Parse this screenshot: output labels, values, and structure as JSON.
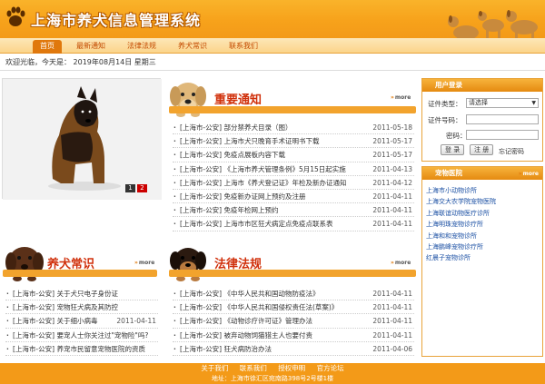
{
  "header": {
    "title": "上海市养犬信息管理系统",
    "logo_icon": "paw-icon",
    "banner_icon": "dogs-banner-image"
  },
  "nav": {
    "items": [
      "首页",
      "最新通知",
      "法律法规",
      "养犬常识",
      "联系我们"
    ],
    "active_index": 0
  },
  "welcome": {
    "text": "欢迎光临，今天是：  2019年08月14日 星期三"
  },
  "slideshow": {
    "pages": [
      "1",
      "2"
    ],
    "current": "2"
  },
  "notice": {
    "title": "重要通知",
    "more": "more",
    "items": [
      {
        "text": "[上海市-公安] 部分禁养犬目录（图）",
        "date": "2011-05-18"
      },
      {
        "text": "[上海市-公安] 上海市犬只晚育手术证明书下载",
        "date": "2011-05-17"
      },
      {
        "text": "[上海市-公安] 免疫点展板内容下载",
        "date": "2011-05-17"
      },
      {
        "text": "[上海市-公安] 《上海市养犬管理条例》5月15日起实施",
        "date": "2011-04-13"
      },
      {
        "text": "[上海市-公安] 上海市《养犬登记证》年检及新办证通知",
        "date": "2011-04-12"
      },
      {
        "text": "[上海市-公安] 免疫新办证网上预约及注册",
        "date": "2011-04-11"
      },
      {
        "text": "[上海市-公安] 免疫年检网上预约",
        "date": "2011-04-11"
      },
      {
        "text": "[上海市-公安] 上海市市区狂犬病定点免疫点联系表",
        "date": "2011-04-11"
      }
    ]
  },
  "knowledge": {
    "title": "养犬常识",
    "more": "more",
    "items": [
      {
        "text": "[上海市-公安] 关于犬只电子身份证",
        "date": ""
      },
      {
        "text": "[上海市-公安] 宠物狂犬病及其防控",
        "date": ""
      },
      {
        "text": "[上海市-公安] 关于细小病毒",
        "date": "2011-04-11"
      },
      {
        "text": "[上海市-公安] 要宠人士你关注过\"宠物险\"吗?",
        "date": ""
      },
      {
        "text": "[上海市-公安] 养宠市民留意宠物医院的资质",
        "date": ""
      }
    ]
  },
  "laws": {
    "title": "法律法规",
    "more": "more",
    "items": [
      {
        "text": "[上海市-公安] 《中华人民共和国动物防疫法》",
        "date": "2011-04-11"
      },
      {
        "text": "[上海市-公安] 《中华人民共和国侵权责任法(草案)》",
        "date": "2011-04-11"
      },
      {
        "text": "[上海市-公安] 《动物诊疗许可证》管理办法",
        "date": "2011-04-11"
      },
      {
        "text": "[上海市-公安] 被弃动物饲猫猎主人也要付责",
        "date": "2011-04-11"
      },
      {
        "text": "[上海市-公安] 狂犬病防治办法",
        "date": "2011-04-06"
      }
    ]
  },
  "login": {
    "title": "用户登录",
    "type_label": "证件类型：",
    "type_value": "请选择",
    "id_label": "证件号码：",
    "pwd_label": "密码：",
    "login_btn": "登 录",
    "register_btn": "注 册",
    "forgot": "忘记密码"
  },
  "hospitals": {
    "title": "宠物医院",
    "more": "more",
    "items": [
      "上海市小动物诊所",
      "上海交大农学院宠物医院",
      "上海联谊动物医疗诊所",
      "上海明珠宠物诊疗所",
      "上海和和宠物诊所",
      "上海鹏峰宠物诊疗所",
      "红晨子宠物诊所"
    ]
  },
  "footer": {
    "links": [
      "关于我们",
      "联系我们",
      "授权申明",
      "官方论坛"
    ],
    "address": "地址：上海市徐汇区宛南路398号2号楼1楼"
  },
  "colors": {
    "brand_orange": "#f39a18",
    "title_red": "#d0300b",
    "link_blue": "#1a4fa3"
  }
}
